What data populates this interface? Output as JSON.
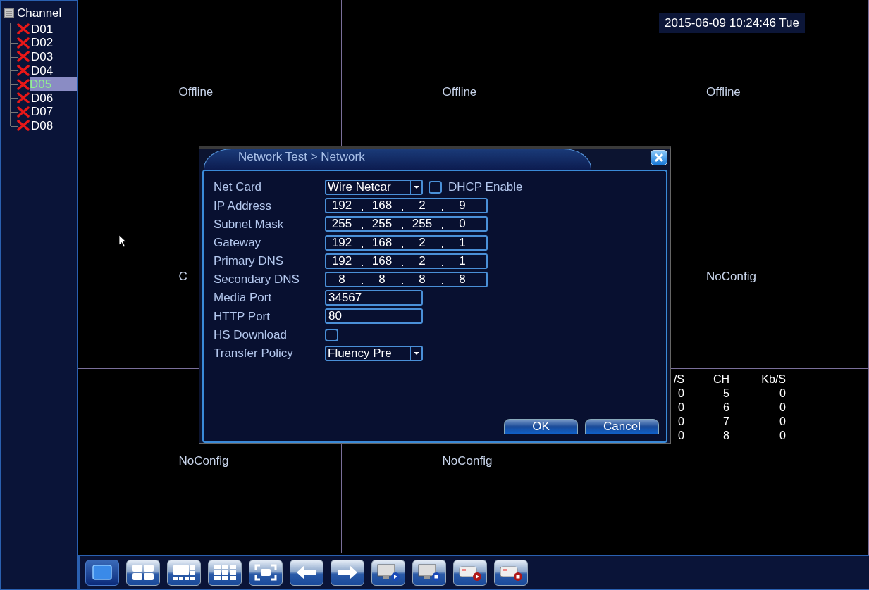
{
  "sidebar": {
    "title": "Channel",
    "items": [
      {
        "label": "D01",
        "offline": true,
        "selected": false
      },
      {
        "label": "D02",
        "offline": true,
        "selected": false
      },
      {
        "label": "D03",
        "offline": true,
        "selected": false
      },
      {
        "label": "D04",
        "offline": true,
        "selected": false
      },
      {
        "label": "D05",
        "offline": true,
        "selected": true
      },
      {
        "label": "D06",
        "offline": true,
        "selected": false
      },
      {
        "label": "D07",
        "offline": true,
        "selected": false
      },
      {
        "label": "D08",
        "offline": true,
        "selected": false
      }
    ]
  },
  "datetime": "2015-06-09 10:24:46 Tue",
  "cells": [
    {
      "label": "Offline"
    },
    {
      "label": "Offline"
    },
    {
      "label": "Offline"
    },
    {
      "label": "C"
    },
    {},
    {
      "label": "NoConfig"
    },
    {
      "label": "NoConfig"
    },
    {
      "label": "NoConfig"
    },
    {
      "stats": {
        "columns": [
          "/S",
          "CH",
          "Kb/S"
        ],
        "rows": [
          [
            "0",
            "5",
            "0"
          ],
          [
            "0",
            "6",
            "0"
          ],
          [
            "0",
            "7",
            "0"
          ],
          [
            "0",
            "8",
            "0"
          ]
        ]
      }
    }
  ],
  "dialog": {
    "title": "Network Test > Network",
    "fields": [
      {
        "kind": "select",
        "label": "Net Card",
        "value": "Wire Netcar",
        "checkbox": {
          "label": "DHCP Enable",
          "checked": false
        }
      },
      {
        "kind": "ip",
        "label": "IP Address",
        "octets": [
          "192",
          "168",
          "2",
          "9"
        ]
      },
      {
        "kind": "ip",
        "label": "Subnet Mask",
        "octets": [
          "255",
          "255",
          "255",
          "0"
        ]
      },
      {
        "kind": "ip",
        "label": "Gateway",
        "octets": [
          "192",
          "168",
          "2",
          "1"
        ]
      },
      {
        "kind": "ip",
        "label": "Primary DNS",
        "octets": [
          "192",
          "168",
          "2",
          "1"
        ]
      },
      {
        "kind": "ip",
        "label": "Secondary DNS",
        "octets": [
          "8",
          "8",
          "8",
          "8"
        ]
      },
      {
        "kind": "text",
        "label": "Media Port",
        "value": "34567"
      },
      {
        "kind": "text",
        "label": "HTTP Port",
        "value": "80"
      },
      {
        "kind": "checkbox",
        "label": "HS Download",
        "checked": false
      },
      {
        "kind": "select",
        "label": "Transfer Policy",
        "value": "Fluency Pre"
      }
    ],
    "buttons": [
      "OK",
      "Cancel"
    ]
  },
  "toolbar": [
    {
      "kind": "single",
      "selected": true
    },
    {
      "kind": "quad",
      "selected": false
    },
    {
      "kind": "six",
      "selected": false
    },
    {
      "kind": "nine",
      "selected": false
    },
    {
      "kind": "fullscreen",
      "selected": false
    },
    {
      "kind": "prev",
      "selected": false
    },
    {
      "kind": "next",
      "selected": false
    },
    {
      "kind": "monitor-play",
      "selected": false
    },
    {
      "kind": "monitor-stop",
      "selected": false
    },
    {
      "kind": "record-play",
      "selected": false
    },
    {
      "kind": "record-stop",
      "selected": false
    }
  ]
}
